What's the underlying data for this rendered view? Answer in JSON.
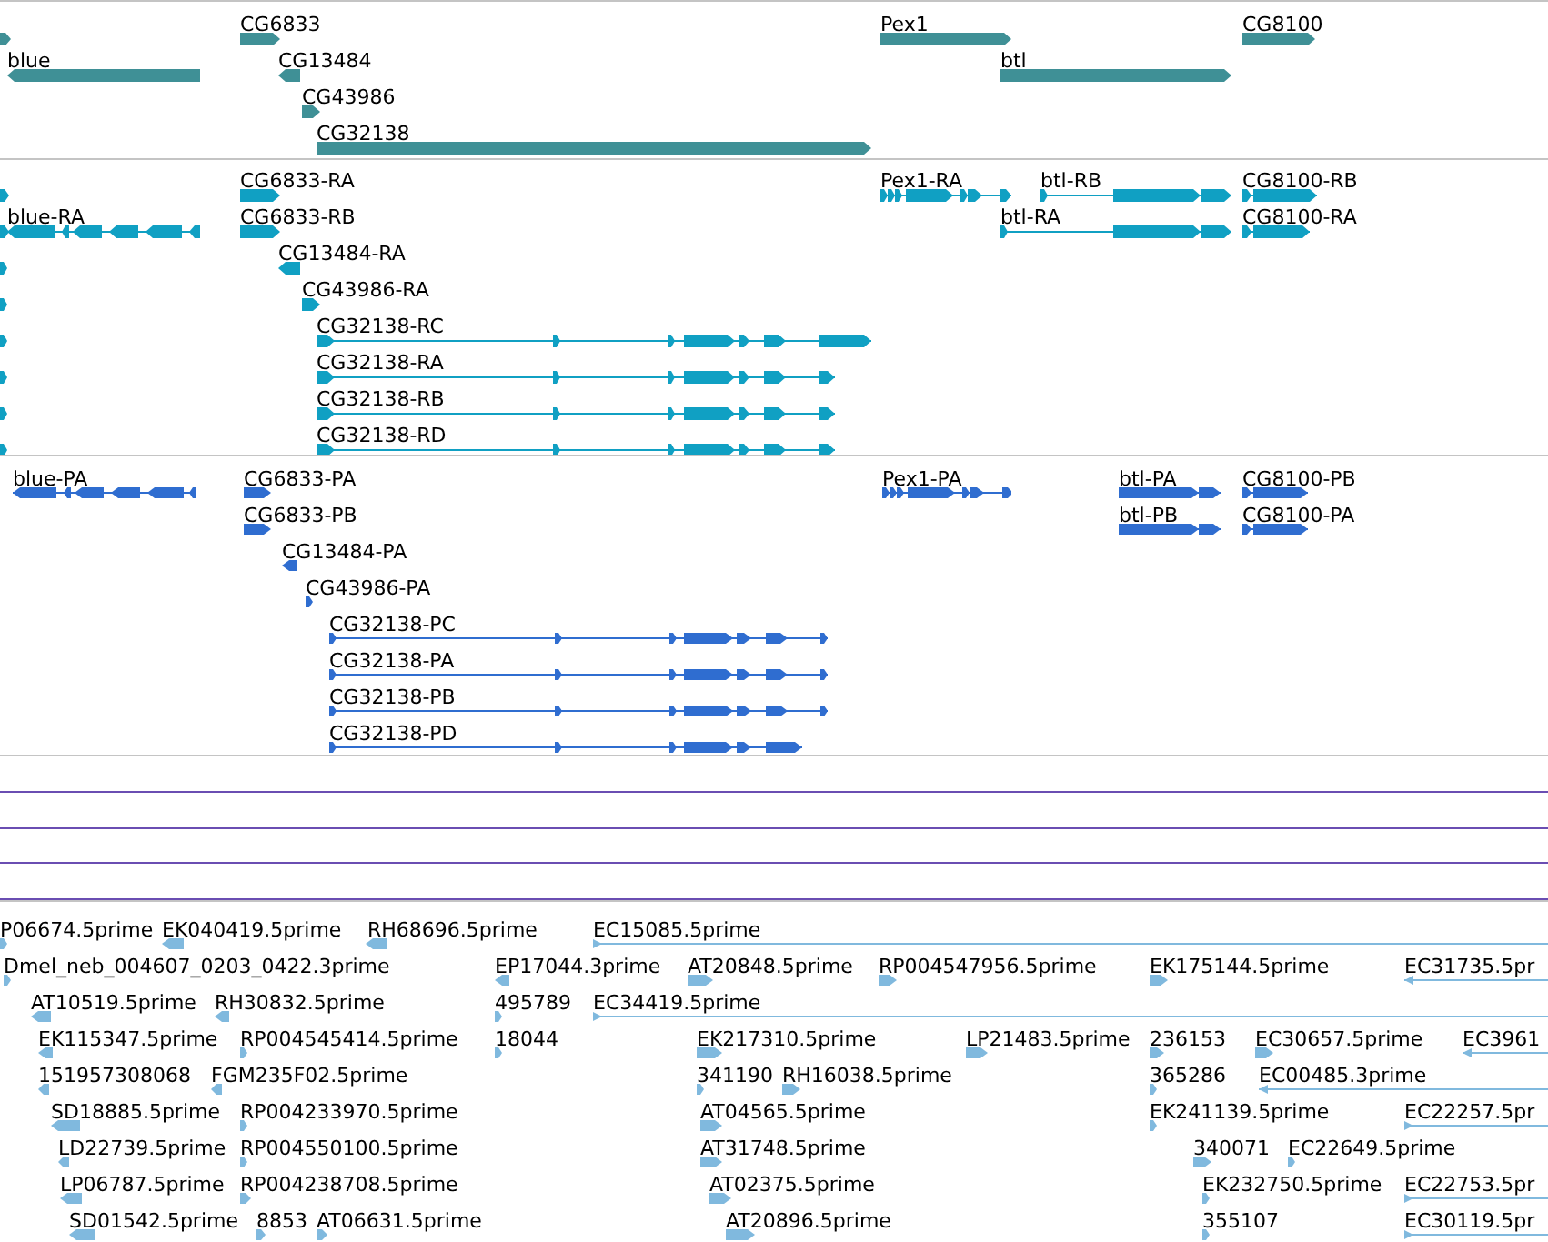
{
  "tracks": [
    {
      "kind": "gene",
      "features": [
        {
          "reverse": false
        },
        {
          "label": "blue",
          "reverse": true
        },
        {
          "label": "CG6833",
          "reverse": false
        },
        {
          "label": "CG13484",
          "reverse": true
        },
        {
          "label": "CG43986",
          "reverse": false
        },
        {
          "label": "CG32138",
          "reverse": false
        },
        {
          "label": "Pex1",
          "reverse": false
        },
        {
          "label": "btl",
          "reverse": false
        },
        {
          "label": "CG8100",
          "reverse": false
        }
      ]
    },
    {
      "kind": "transcript",
      "features": [
        {
          "reverse": false
        },
        {
          "reverse": false
        },
        {
          "reverse": false
        },
        {
          "reverse": false
        },
        {
          "reverse": false
        },
        {
          "reverse": false
        },
        {
          "reverse": false
        },
        {
          "reverse": false
        },
        {
          "label": "blue-RA",
          "reverse": true
        },
        {
          "label": "CG6833-RA",
          "reverse": false
        },
        {
          "label": "CG6833-RB",
          "reverse": false
        },
        {
          "label": "CG13484-RA",
          "reverse": true
        },
        {
          "label": "CG43986-RA",
          "reverse": false
        },
        {
          "label": "CG32138-RC",
          "reverse": false
        },
        {
          "label": "CG32138-RA",
          "reverse": false
        },
        {
          "label": "CG32138-RB",
          "reverse": false
        },
        {
          "label": "CG32138-RD",
          "reverse": false
        },
        {
          "label": "Pex1-RA",
          "reverse": false
        },
        {
          "label": "btl-RB",
          "reverse": false
        },
        {
          "label": "btl-RA",
          "reverse": false
        },
        {
          "label": "CG8100-RB",
          "reverse": false
        },
        {
          "label": "CG8100-RA",
          "reverse": false
        }
      ]
    },
    {
      "kind": "protein",
      "features": [
        {
          "label": "blue-PA",
          "reverse": true
        },
        {
          "label": "CG6833-PA",
          "reverse": false
        },
        {
          "label": "CG6833-PB",
          "reverse": false
        },
        {
          "label": "CG13484-PA",
          "reverse": true
        },
        {
          "label": "CG43986-PA",
          "reverse": false
        },
        {
          "label": "CG32138-PC",
          "reverse": false
        },
        {
          "label": "CG32138-PA",
          "reverse": false
        },
        {
          "label": "CG32138-PB",
          "reverse": false
        },
        {
          "label": "CG32138-PD",
          "reverse": false
        },
        {
          "label": "Pex1-PA",
          "reverse": false
        },
        {
          "label": "btl-PA",
          "reverse": false
        },
        {
          "label": "btl-PB",
          "reverse": false
        },
        {
          "label": "CG8100-PB",
          "reverse": false
        },
        {
          "label": "CG8100-PA",
          "reverse": false
        }
      ]
    },
    {
      "kind": "span"
    },
    {
      "kind": "est",
      "features": [
        {
          "label": "P06674.5prime",
          "reverse": false
        },
        {
          "label": "EK040419.5prime",
          "reverse": true
        },
        {
          "label": "RH68696.5prime",
          "reverse": true
        },
        {
          "label": "EC15085.5prime",
          "reverse": false
        },
        {
          "label": "Dmel_neb_004607_0203_0422.3prime",
          "reverse": false
        },
        {
          "label": "EP17044.3prime",
          "reverse": true
        },
        {
          "label": "AT20848.5prime",
          "reverse": false
        },
        {
          "label": "RP004547956.5prime",
          "reverse": false
        },
        {
          "label": "EK175144.5prime",
          "reverse": false
        },
        {
          "label": "EC31735.5pr",
          "reverse": true
        },
        {
          "label": "AT10519.5prime",
          "reverse": true
        },
        {
          "label": "RH30832.5prime",
          "reverse": true
        },
        {
          "label": "495789",
          "reverse": false
        },
        {
          "label": "EC34419.5prime",
          "reverse": false
        },
        {
          "label": "EK115347.5prime",
          "reverse": true
        },
        {
          "label": "RP004545414.5prime",
          "reverse": false
        },
        {
          "label": "18044",
          "reverse": false
        },
        {
          "label": "EK217310.5prime",
          "reverse": false
        },
        {
          "label": "LP21483.5prime",
          "reverse": false
        },
        {
          "label": "236153",
          "reverse": false
        },
        {
          "label": "EC30657.5prime",
          "reverse": false
        },
        {
          "label": "EC3961",
          "reverse": true
        },
        {
          "label": "151957308068",
          "reverse": true
        },
        {
          "label": "FGM235F02.5prime",
          "reverse": true
        },
        {
          "label": "341190",
          "reverse": false
        },
        {
          "label": "RH16038.5prime",
          "reverse": false
        },
        {
          "label": "365286",
          "reverse": false
        },
        {
          "label": "EC00485.3prime",
          "reverse": true
        },
        {
          "label": "SD18885.5prime",
          "reverse": true
        },
        {
          "label": "RP004233970.5prime",
          "reverse": false
        },
        {
          "label": "AT04565.5prime",
          "reverse": false
        },
        {
          "label": "EK241139.5prime",
          "reverse": false
        },
        {
          "label": "EC22257.5pr",
          "reverse": false
        },
        {
          "label": "LD22739.5prime",
          "reverse": true
        },
        {
          "label": "RP004550100.5prime",
          "reverse": false
        },
        {
          "label": "AT31748.5prime",
          "reverse": false
        },
        {
          "label": "340071",
          "reverse": false
        },
        {
          "label": "EC22649.5prime",
          "reverse": false
        },
        {
          "label": "LP06787.5prime",
          "reverse": true
        },
        {
          "label": "RP004238708.5prime",
          "reverse": false
        },
        {
          "label": "AT02375.5prime",
          "reverse": false
        },
        {
          "label": "EK232750.5prime",
          "reverse": false
        },
        {
          "label": "EC22753.5pr",
          "reverse": false
        },
        {
          "label": "SD01542.5prime",
          "reverse": true
        },
        {
          "label": "8853",
          "reverse": false
        },
        {
          "label": "AT06631.5prime",
          "reverse": false
        },
        {
          "label": "AT20896.5prime",
          "reverse": false
        },
        {
          "label": "355107",
          "reverse": false
        },
        {
          "label": "EC30119.5pr",
          "reverse": false
        }
      ]
    }
  ]
}
